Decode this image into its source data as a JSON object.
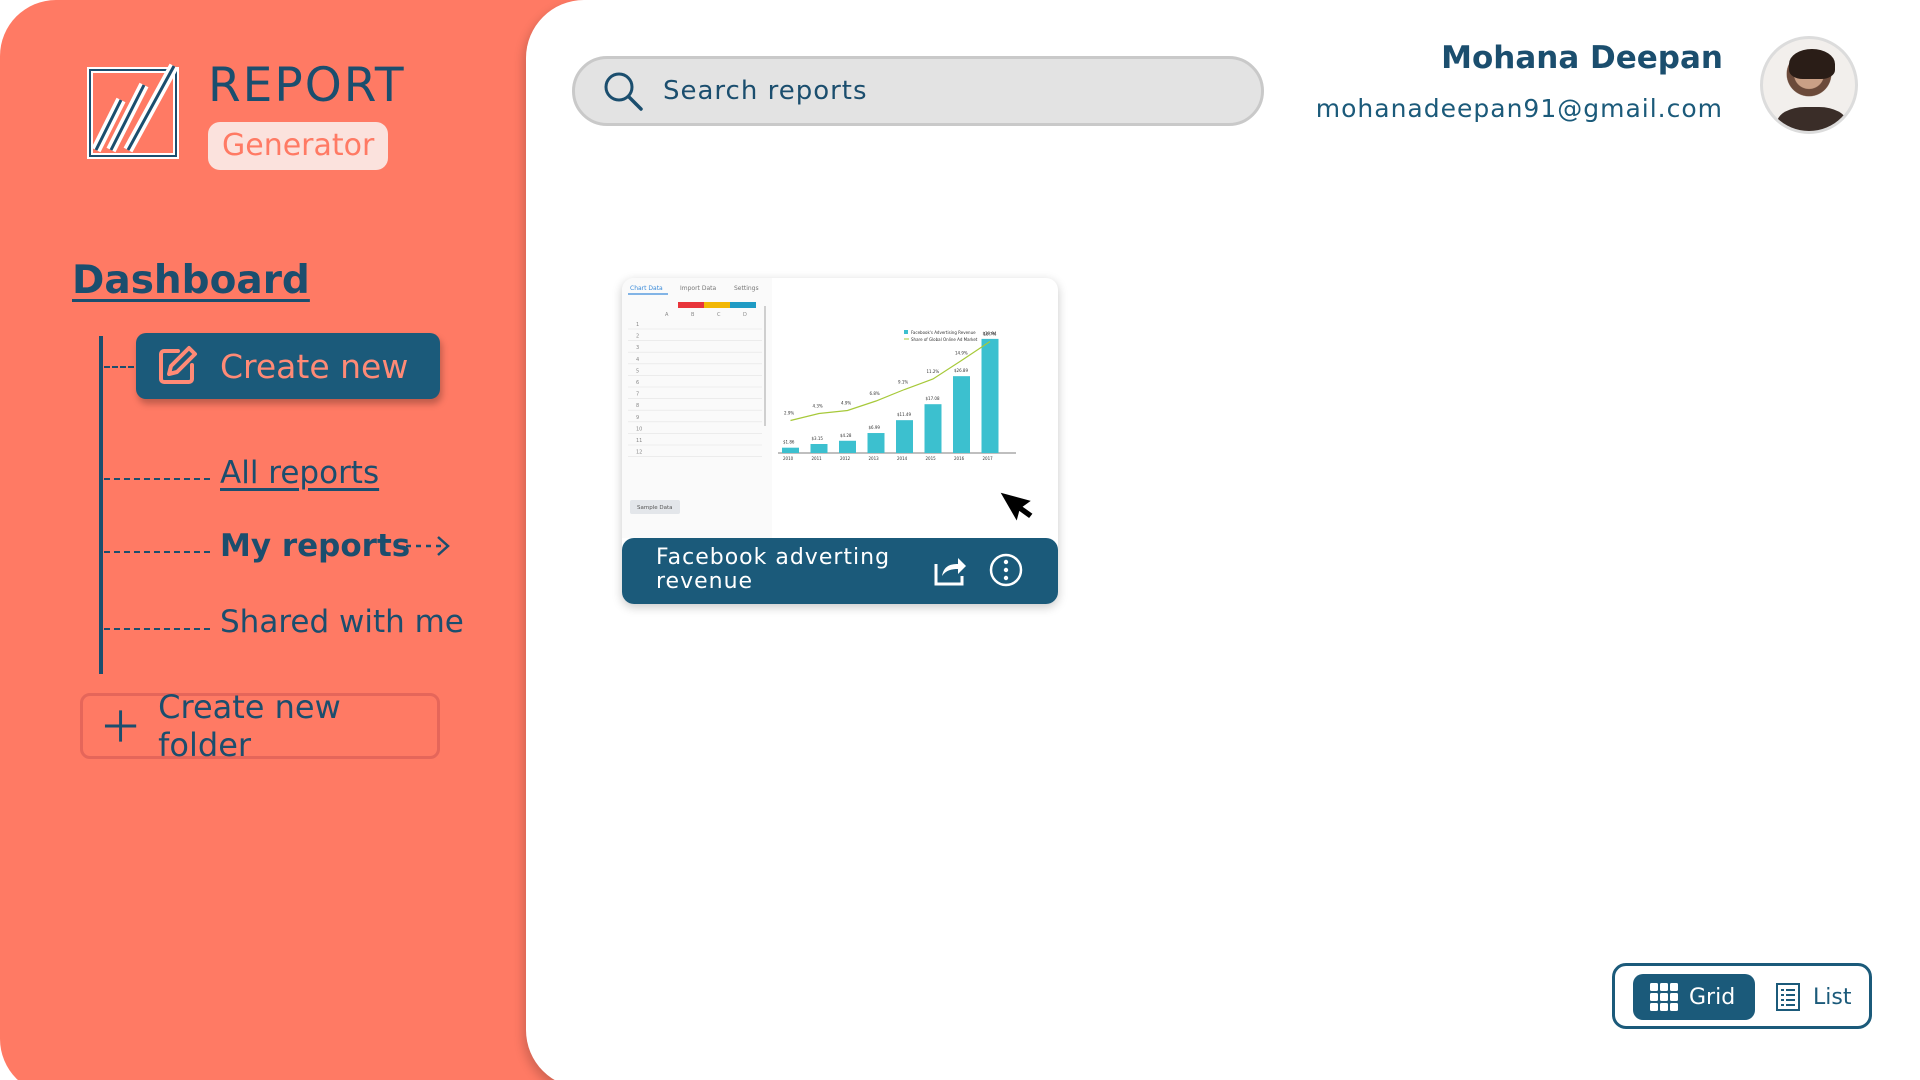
{
  "brand": {
    "title": "REPORT",
    "subtitle": "Generator"
  },
  "sidebar": {
    "heading": "Dashboard",
    "create_new_label": "Create new",
    "items": [
      {
        "label": "All reports"
      },
      {
        "label": "My reports"
      },
      {
        "label": "Shared with me"
      }
    ],
    "create_folder_label": "Create new folder"
  },
  "search": {
    "placeholder": "Search reports"
  },
  "user": {
    "name": "Mohana Deepan",
    "email": "mohanadeepan91@gmail.com"
  },
  "reports": [
    {
      "title": "Facebook adverting revenue",
      "thumbnail": {
        "tabs": [
          "Chart Data",
          "Import Data",
          "Settings"
        ],
        "columns": [
          "A",
          "B",
          "C",
          "D"
        ],
        "row_numbers": [
          1,
          2,
          3,
          4,
          5,
          6,
          7,
          8,
          9,
          10,
          11,
          12
        ],
        "sample_button": "Sample Data",
        "legend": [
          "Facebook's Advertising Revenue",
          "Share of Global Online Ad Market"
        ],
        "years": [
          "2010",
          "2011",
          "2012",
          "2013",
          "2014",
          "2015",
          "2016",
          "2017"
        ],
        "revenue": [
          1.86,
          3.15,
          4.28,
          6.99,
          11.49,
          17.08,
          26.89,
          39.94
        ],
        "share": [
          2.9,
          4.3,
          4.9,
          6.8,
          9.1,
          11.2,
          14.9,
          18.7
        ]
      }
    }
  ],
  "view_toggle": {
    "grid_label": "Grid",
    "list_label": "List",
    "active": "grid"
  },
  "colors": {
    "sidebar": "#FF7A64",
    "primary": "#1B5A7A",
    "text": "#1B4E6E",
    "bar": "#3CC0CF",
    "line": "#A7C93A"
  }
}
